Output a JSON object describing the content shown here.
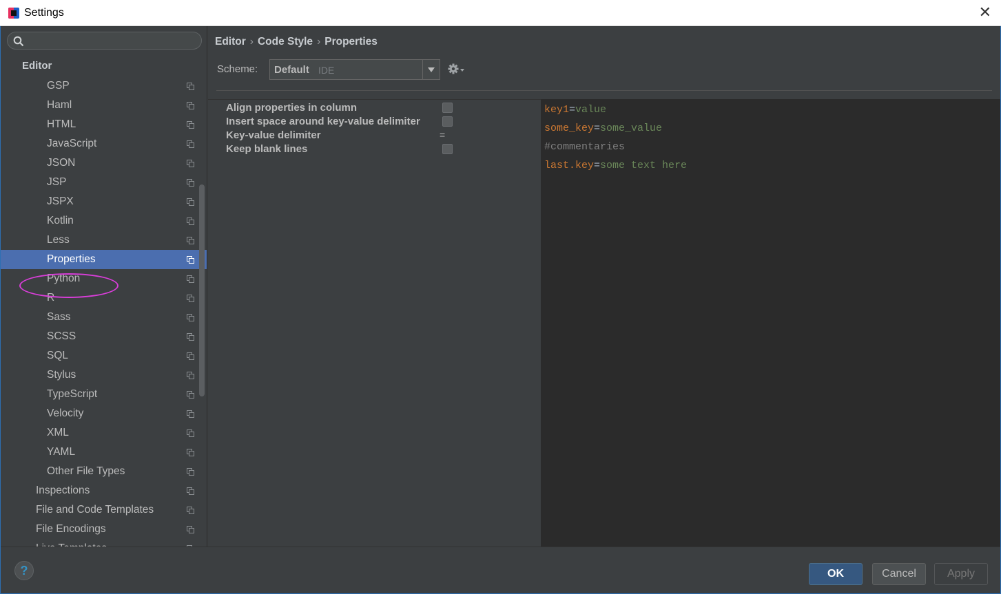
{
  "window": {
    "title": "Settings",
    "close_glyph": "✕"
  },
  "search": {
    "placeholder": ""
  },
  "tree": {
    "header": "Editor",
    "items": [
      {
        "label": "GSP"
      },
      {
        "label": "Haml"
      },
      {
        "label": "HTML"
      },
      {
        "label": "JavaScript"
      },
      {
        "label": "JSON"
      },
      {
        "label": "JSP"
      },
      {
        "label": "JSPX"
      },
      {
        "label": "Kotlin"
      },
      {
        "label": "Less"
      },
      {
        "label": "Properties",
        "selected": true
      },
      {
        "label": "Python"
      },
      {
        "label": "R"
      },
      {
        "label": "Sass"
      },
      {
        "label": "SCSS"
      },
      {
        "label": "SQL"
      },
      {
        "label": "Stylus"
      },
      {
        "label": "TypeScript"
      },
      {
        "label": "Velocity"
      },
      {
        "label": "XML"
      },
      {
        "label": "YAML"
      },
      {
        "label": "Other File Types"
      },
      {
        "label": "Inspections"
      },
      {
        "label": "File and Code Templates"
      },
      {
        "label": "File Encodings"
      },
      {
        "label": "Live Templates"
      }
    ]
  },
  "breadcrumb": {
    "part1": "Editor",
    "part2": "Code Style",
    "part3": "Properties",
    "sep": "›"
  },
  "scheme": {
    "label": "Scheme:",
    "value": "Default",
    "sub": "IDE"
  },
  "options": {
    "align": "Align properties in column",
    "insert_space": "Insert space around key-value delimiter",
    "delimiter_label": "Key-value delimiter",
    "delimiter_value": "=",
    "keep_blank": "Keep blank lines"
  },
  "preview": {
    "line1": {
      "key": "key1",
      "eq": "=",
      "value": "value"
    },
    "line2": {
      "key": "some_key",
      "eq": "=",
      "value": "some_value"
    },
    "line3": {
      "comment": "#commentaries"
    },
    "line4": {
      "key": "last.key",
      "eq": "=",
      "value": "some text here"
    }
  },
  "footer": {
    "help": "?",
    "ok": "OK",
    "cancel": "Cancel",
    "apply": "Apply"
  },
  "colors": {
    "accent": "#4b6eaf",
    "background": "#3c3f41",
    "editor_bg": "#2b2b2b",
    "key": "#cc7832",
    "value": "#6a8759",
    "comment": "#808080"
  },
  "icons": {
    "search": "search-icon",
    "gear": "gear-icon",
    "copy": "copy-icon",
    "help": "help-icon",
    "close": "close-icon"
  }
}
